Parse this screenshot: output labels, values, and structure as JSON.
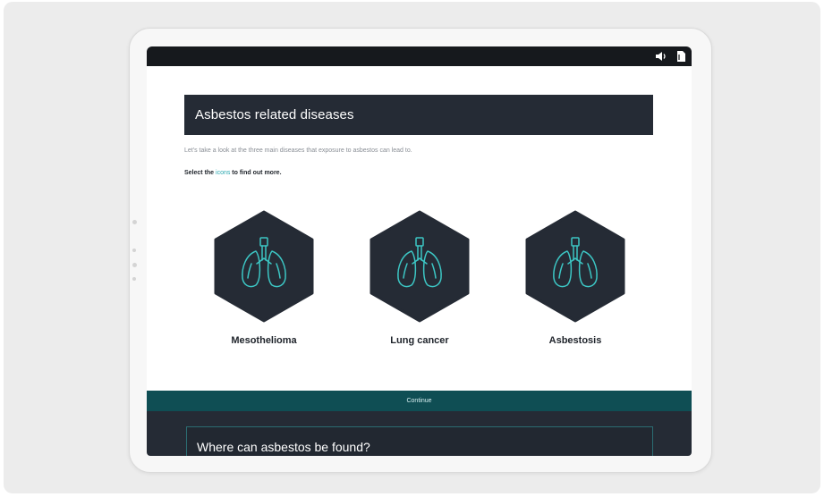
{
  "header": {
    "title": "Asbestos related diseases"
  },
  "intro_text": "Let's take a look at the three main diseases that exposure to asbestos can lead to.",
  "instruction": {
    "before": "Select the ",
    "link": "icons",
    "after": " to find out more."
  },
  "diseases": [
    {
      "label": "Mesothelioma",
      "icon": "lungs-icon"
    },
    {
      "label": "Lung cancer",
      "icon": "lungs-icon"
    },
    {
      "label": "Asbestosis",
      "icon": "lungs-icon"
    }
  ],
  "continue_label": "Continue",
  "next_section": {
    "title": "Where can asbestos be found?"
  },
  "topbar_icons": [
    "speaker-icon",
    "document-icon"
  ],
  "colors": {
    "dark": "#252b35",
    "accent": "#2aa8b0",
    "continue_bar": "#0f4e54",
    "topbar": "#16191d"
  }
}
